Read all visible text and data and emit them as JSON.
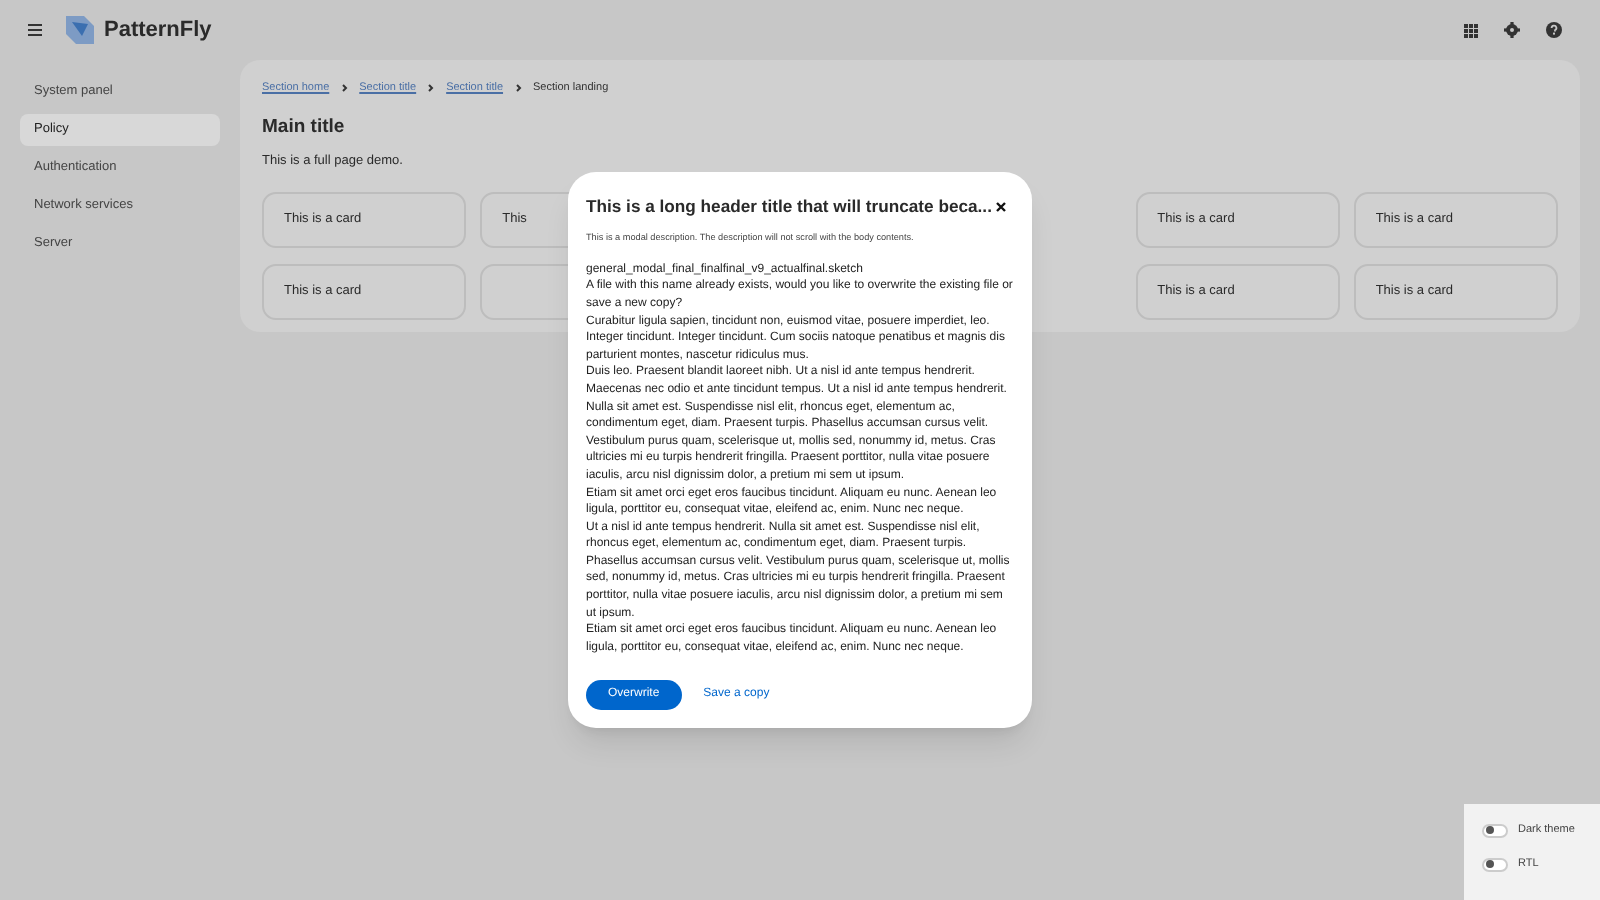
{
  "header": {
    "brand": "PatternFly"
  },
  "sidebar": {
    "items": [
      {
        "label": "System panel",
        "selected": false
      },
      {
        "label": "Policy",
        "selected": true
      },
      {
        "label": "Authentication",
        "selected": false
      },
      {
        "label": "Network services",
        "selected": false
      },
      {
        "label": "Server",
        "selected": false
      }
    ]
  },
  "breadcrumb": [
    {
      "label": "Section home",
      "kind": "link"
    },
    {
      "label": "Section title",
      "kind": "link"
    },
    {
      "label": "Section title",
      "kind": "link"
    },
    {
      "label": "Section landing",
      "kind": "current"
    }
  ],
  "main": {
    "title": "Main title",
    "subtitle": "This is a full page demo."
  },
  "cards": [
    {
      "kind": "card",
      "label": "This is a card"
    },
    {
      "kind": "card",
      "label": "This"
    },
    {
      "kind": "covered"
    },
    {
      "kind": "covered"
    },
    {
      "kind": "card",
      "label": "This is a card"
    },
    {
      "kind": "card",
      "label": "This is a card"
    },
    {
      "kind": "card",
      "label": "This is a card"
    },
    {
      "kind": "card"
    },
    {
      "kind": "covered"
    },
    {
      "kind": "covered"
    },
    {
      "kind": "card",
      "label": "This is a card"
    },
    {
      "kind": "card",
      "label": "This is a card"
    }
  ],
  "modal": {
    "title": "This is a long header title that will truncate beca...",
    "description": "This is a modal description. The description will not scroll with the body contents.",
    "body": [
      "general_modal_final_finalfinal_v9_actualfinal.sketch",
      "A file with this name already exists, would you like to overwrite the existing file or save a new copy?",
      "Curabitur ligula sapien, tincidunt non, euismod vitae, posuere imperdiet, leo. Integer tincidunt. Integer tincidunt. Cum sociis natoque penatibus et magnis dis parturient montes, nascetur ridiculus mus.",
      "Duis leo. Praesent blandit laoreet nibh. Ut a nisl id ante tempus hendrerit. Maecenas nec odio et ante tincidunt tempus. Ut a nisl id ante tempus hendrerit. Nulla sit amet est. Suspendisse nisl elit, rhoncus eget, elementum ac, condimentum eget, diam. Praesent turpis. Phasellus accumsan cursus velit. Vestibulum purus quam, scelerisque ut, mollis sed, nonummy id, metus. Cras ultricies mi eu turpis hendrerit fringilla. Praesent porttitor, nulla vitae posuere iaculis, arcu nisl dignissim dolor, a pretium mi sem ut ipsum.",
      "Etiam sit amet orci eget eros faucibus tincidunt. Aliquam eu nunc. Aenean leo ligula, porttitor eu, consequat vitae, eleifend ac, enim. Nunc nec neque.",
      "Ut a nisl id ante tempus hendrerit. Nulla sit amet est. Suspendisse nisl elit, rhoncus eget, elementum ac, condimentum eget, diam. Praesent turpis. Phasellus accumsan cursus velit. Vestibulum purus quam, scelerisque ut, mollis sed, nonummy id, metus. Cras ultricies mi eu turpis hendrerit fringilla. Praesent porttitor, nulla vitae posuere iaculis, arcu nisl dignissim dolor, a pretium mi sem ut ipsum.",
      "Etiam sit amet orci eget eros faucibus tincidunt. Aliquam eu nunc. Aenean leo ligula, porttitor eu, consequat vitae, eleifend ac, enim. Nunc nec neque."
    ],
    "buttons": [
      {
        "label": "Overwrite",
        "kind": "primary"
      },
      {
        "label": "Save a copy",
        "kind": "link"
      }
    ]
  },
  "toggles": [
    {
      "label": "Dark theme",
      "on": false
    },
    {
      "label": "RTL",
      "on": false
    }
  ]
}
